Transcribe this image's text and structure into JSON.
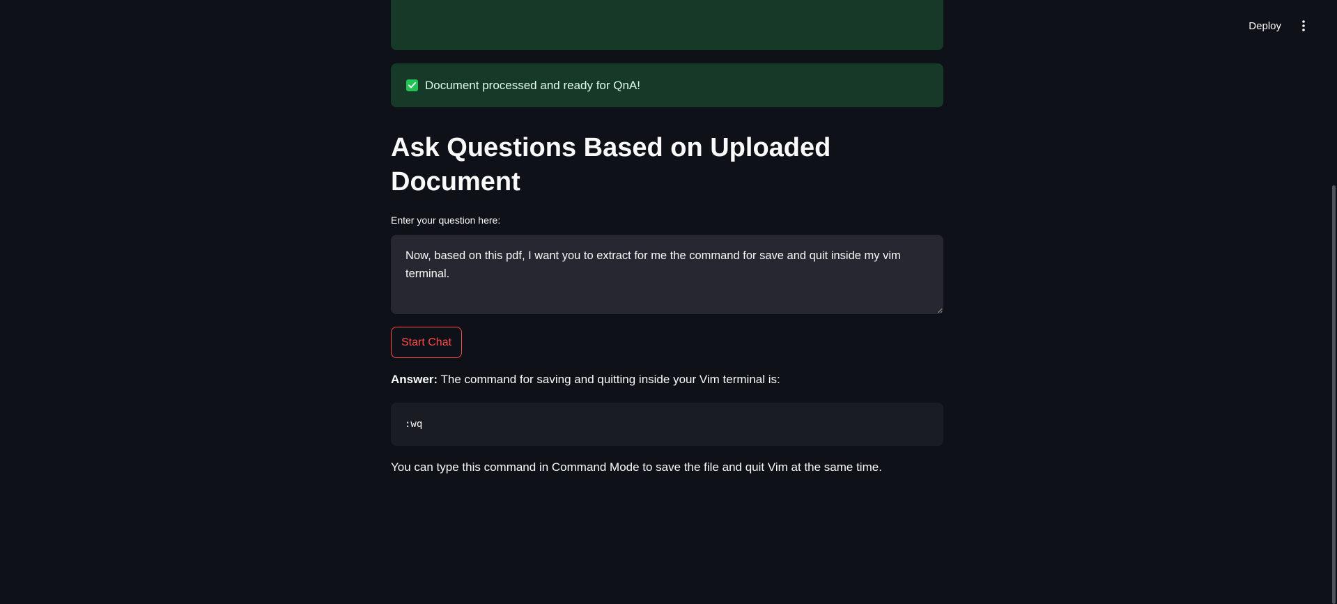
{
  "header": {
    "deploy_label": "Deploy",
    "menu_icon": "vertical-ellipsis-icon"
  },
  "alert": {
    "icon": "check-box-icon",
    "message": "Document processed and ready for QnA!",
    "color": "#173928",
    "icon_color": "#21c354"
  },
  "main": {
    "title": "Ask Questions Based on Uploaded Document",
    "question_label": "Enter your question here:",
    "question_value": "Now, based on this pdf, I want you to extract for me the command for save and quit inside my vim terminal.",
    "start_button_label": "Start Chat",
    "answer_label": "Answer:",
    "answer_text": " The command for saving and quitting inside your Vim terminal is:",
    "code": ":wq",
    "follow_up": "You can type this command in Command Mode to save the file and quit Vim at the same time."
  },
  "colors": {
    "background": "#0e1117",
    "accent": "#ff4b4b",
    "input_bg": "#262730",
    "code_bg": "#1a1c24"
  }
}
